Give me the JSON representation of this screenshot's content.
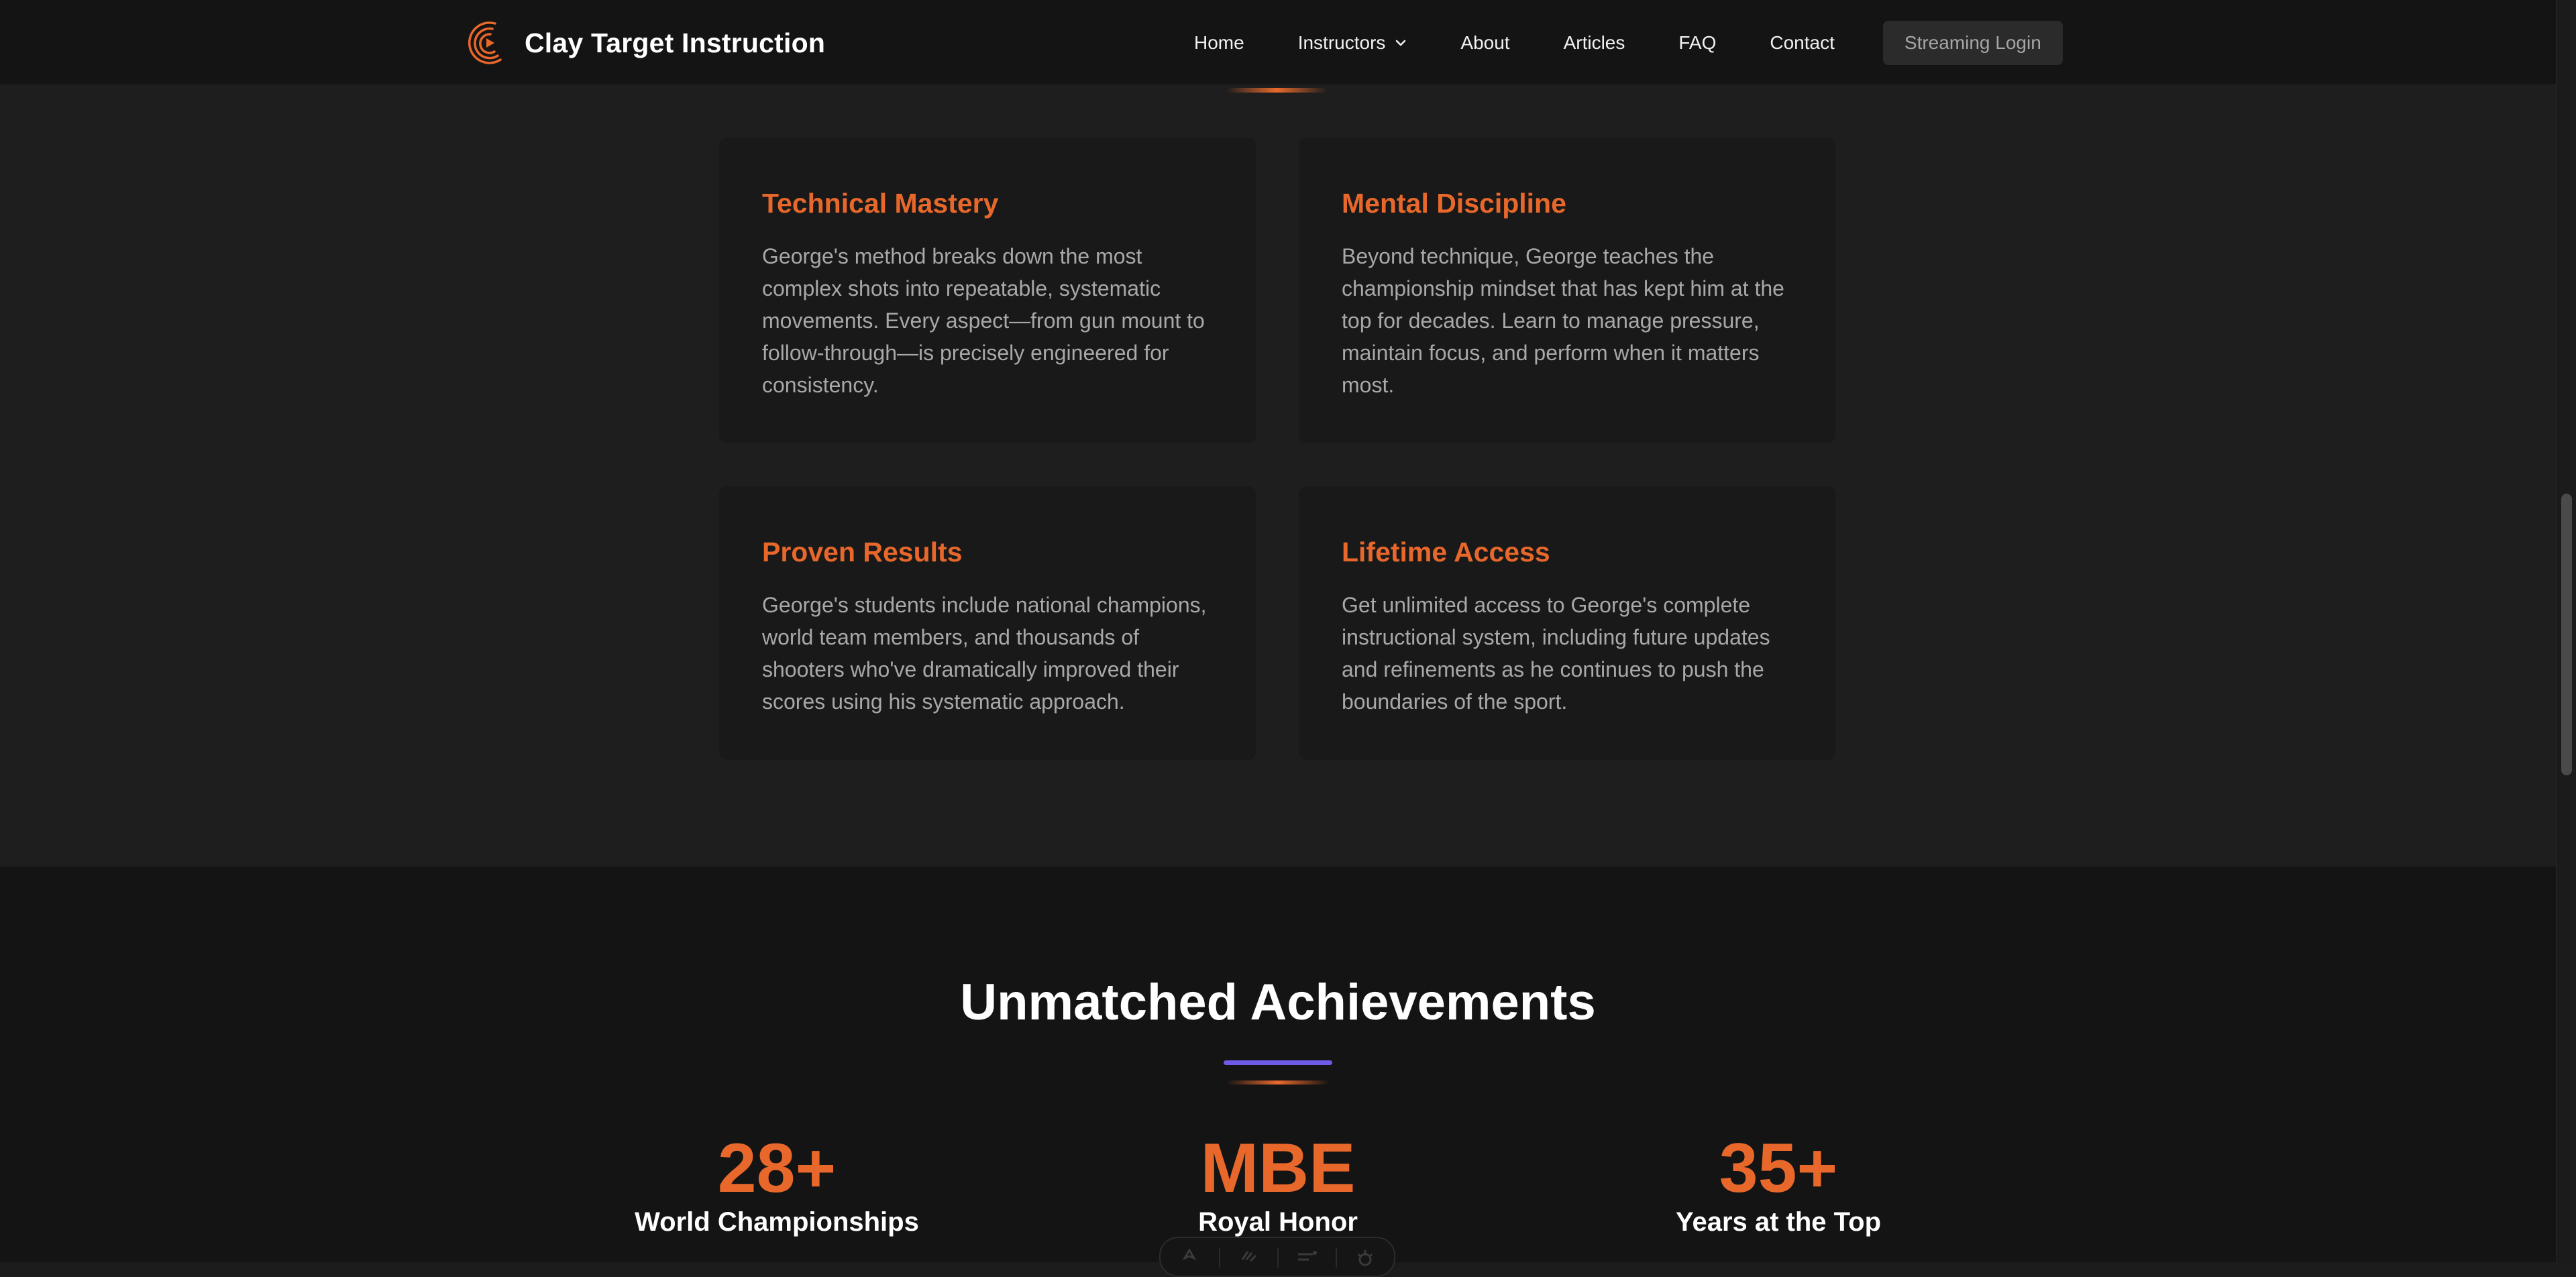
{
  "header": {
    "brand_name": "Clay Target Instruction",
    "logo_icon": "play-swirl-logo-icon",
    "nav": [
      {
        "label": "Home"
      },
      {
        "label": "Instructors",
        "has_dropdown": true
      },
      {
        "label": "About"
      },
      {
        "label": "Articles"
      },
      {
        "label": "FAQ"
      },
      {
        "label": "Contact"
      }
    ],
    "login_label": "Streaming Login"
  },
  "features": {
    "cards": [
      {
        "title": "Technical Mastery",
        "text": "George's method breaks down the most complex shots into repeatable, systematic movements. Every aspect—from gun mount to follow-through—is precisely engineered for consistency."
      },
      {
        "title": "Mental Discipline",
        "text": "Beyond technique, George teaches the championship mindset that has kept him at the top for decades. Learn to manage pressure, maintain focus, and perform when it matters most."
      },
      {
        "title": "Proven Results",
        "text": "George's students include national champions, world team members, and thousands of shooters who've dramatically improved their scores using his systematic approach."
      },
      {
        "title": "Lifetime Access",
        "text": "Get unlimited access to George's complete instructional system, including future updates and refinements as he continues to push the boundaries of the sport."
      }
    ]
  },
  "achievements": {
    "title": "Unmatched Achievements",
    "stats": [
      {
        "value": "28+",
        "label": "World Championships"
      },
      {
        "value": "MBE",
        "label": "Royal Honor"
      },
      {
        "value": "35+",
        "label": "Years at the Top"
      }
    ]
  },
  "colors": {
    "accent_orange": "#e8682b",
    "accent_violet": "#6f5bea",
    "page_bg": "#1e1e1e",
    "header_bg": "#141414"
  }
}
